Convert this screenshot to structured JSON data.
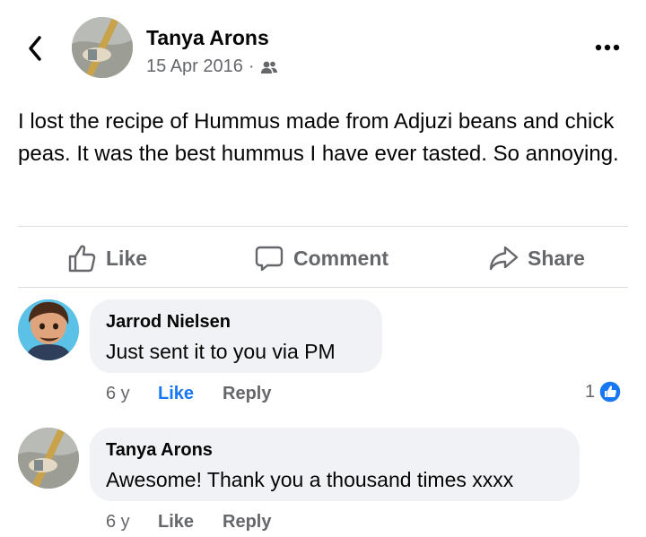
{
  "post": {
    "author": "Tanya Arons",
    "date": "15 Apr 2016",
    "separator": "·",
    "audience_icon": "friends-icon",
    "text": "I lost the recipe of Hummus made from Adjuzi beans and chick peas.  It was the best hummus I have ever tasted.  So annoying."
  },
  "actions": {
    "like": "Like",
    "comment": "Comment",
    "share": "Share"
  },
  "comments": [
    {
      "name": "Jarrod Nielsen",
      "text": "Just sent it to you via PM",
      "time": "6 y",
      "like": "Like",
      "reply": "Reply",
      "reaction_count": "1"
    },
    {
      "name": "Tanya Arons",
      "text": "Awesome! Thank you a thousand times xxxx",
      "time": "6 y",
      "like": "Like",
      "reply": "Reply"
    }
  ],
  "colors": {
    "accent": "#1877f2",
    "secondary_text": "#65676b",
    "bubble": "#f0f2f5"
  }
}
